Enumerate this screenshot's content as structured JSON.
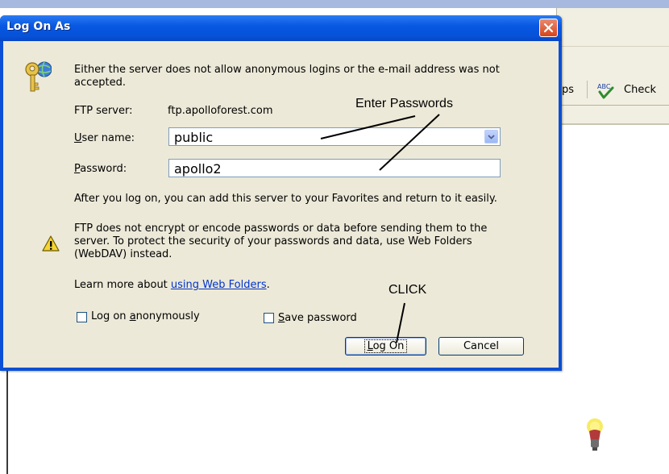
{
  "dialog": {
    "title": "Log On As",
    "message_line1": "Either the server does not allow anonymous logins or the e-mail address was not",
    "message_line2": "accepted.",
    "ftp_server_label": "FTP server:",
    "ftp_server_value": "ftp.apolloforest.com",
    "user_name_label_u": "U",
    "user_name_label_rest": "ser name:",
    "user_name_value": "public",
    "password_label_p": "P",
    "password_label_rest": "assword:",
    "password_value": "apollo2",
    "favorites_note": "After you log on, you can add this server to your Favorites and return to it easily.",
    "warning_line1": "FTP does not encrypt or encode passwords or data before sending them to the",
    "warning_line2": "server.  To protect the security of your passwords and data, use Web Folders",
    "warning_line3": "(WebDAV) instead.",
    "learn_more_prefix": "Learn more about ",
    "learn_more_link": "using Web Folders",
    "learn_more_suffix": ".",
    "anon_label_prefix": "Log on ",
    "anon_label_mnemonic": "a",
    "anon_label_rest": "nonymously",
    "anon_checked": false,
    "save_label_mnemonic": "S",
    "save_label_rest": "ave password",
    "save_checked": false,
    "logon_button_mnemonic": "L",
    "logon_button_rest": "og On",
    "cancel_button": "Cancel",
    "icons": {
      "key": "key-globe-icon",
      "warning": "warning-icon",
      "close": "close-icon",
      "dropdown": "chevron-down-icon"
    }
  },
  "annotations": {
    "enter_passwords": "Enter Passwords",
    "click": "CLICK"
  },
  "background_window": {
    "toolbar_partial": "ps",
    "check_button": "Check",
    "spell_icon_text": "ABC",
    "icons": {
      "spell": "spell-check-icon",
      "lamp": "lamp-icon"
    }
  },
  "colors": {
    "title_bar": "#0858e3",
    "dialog_face": "#ece9d8",
    "close_button": "#d7441b",
    "link": "#0033cc"
  }
}
